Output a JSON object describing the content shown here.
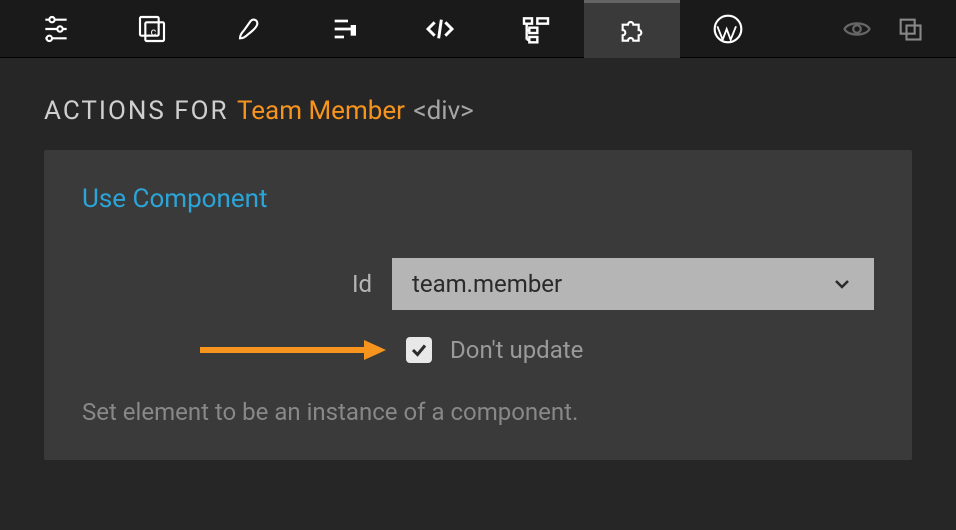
{
  "toolbar": {
    "items": [
      {
        "name": "sliders-icon",
        "active": false
      },
      {
        "name": "component-icon",
        "active": false
      },
      {
        "name": "brush-icon",
        "active": false
      },
      {
        "name": "list-icon",
        "active": false
      },
      {
        "name": "code-icon",
        "active": false
      },
      {
        "name": "tree-icon",
        "active": false
      },
      {
        "name": "puzzle-icon",
        "active": true
      },
      {
        "name": "wordpress-icon",
        "active": false
      }
    ]
  },
  "header": {
    "prefix": "ACTIONS FOR ",
    "element": "Team Member",
    "tag": " <div>"
  },
  "panel": {
    "title": "Use Component",
    "id_label": "Id",
    "id_value": "team.member",
    "checkbox_label": "Don't update",
    "checkbox_checked": true,
    "help_text": "Set element to be an instance of a component."
  }
}
